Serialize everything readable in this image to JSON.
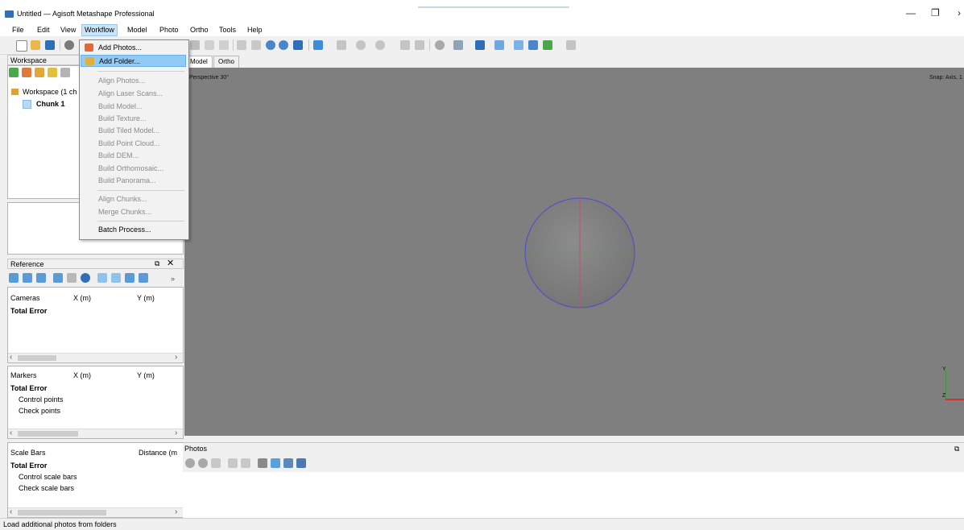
{
  "window": {
    "title": "Untitled — Agisoft Metashape Professional",
    "controls": [
      "—",
      "❐",
      "›"
    ]
  },
  "menubar": [
    "File",
    "Edit",
    "View",
    "Workflow",
    "Model",
    "Photo",
    "Ortho",
    "Tools",
    "Help"
  ],
  "workflow_menu": {
    "items": [
      {
        "label": "Add Photos...",
        "icon": "add-photos-icon",
        "enabled": true
      },
      {
        "label": "Add Folder...",
        "icon": "add-folder-icon",
        "enabled": true,
        "highlighted": true
      },
      {
        "label": "Align Photos...",
        "enabled": false
      },
      {
        "label": "Align Laser Scans...",
        "enabled": false
      },
      {
        "label": "Build Model...",
        "enabled": false
      },
      {
        "label": "Build Texture...",
        "enabled": false
      },
      {
        "label": "Build Tiled Model...",
        "enabled": false
      },
      {
        "label": "Build Point Cloud...",
        "enabled": false
      },
      {
        "label": "Build DEM...",
        "enabled": false
      },
      {
        "label": "Build Orthomosaic...",
        "enabled": false
      },
      {
        "label": "Build Panorama...",
        "enabled": false
      },
      {
        "label": "Align Chunks...",
        "enabled": false
      },
      {
        "label": "Merge Chunks...",
        "enabled": false
      },
      {
        "label": "Batch Process...",
        "enabled": true
      }
    ]
  },
  "workspace": {
    "title": "Workspace",
    "root": "Workspace (1 ch",
    "chunk": "Chunk 1"
  },
  "viewport": {
    "tabs": [
      "Model",
      "Ortho"
    ],
    "projection": "Perspective 30°",
    "snap": "Snap: Axis, 1",
    "axis_y": "Y",
    "axis_z": "Z"
  },
  "reference": {
    "title": "Reference",
    "more": "»",
    "cameras": {
      "headers": [
        "Cameras",
        "X (m)",
        "Y (m)"
      ],
      "rows": [
        "Total Error"
      ]
    },
    "markers": {
      "headers": [
        "Markers",
        "X (m)",
        "Y (m)"
      ],
      "rows": [
        "Total Error",
        "Control points",
        "Check points"
      ]
    },
    "scalebars": {
      "headers": [
        "Scale Bars",
        "Distance (m"
      ],
      "rows": [
        "Total Error",
        "Control scale bars",
        "Check scale bars"
      ]
    }
  },
  "photos": {
    "title": "Photos"
  },
  "status": "Load additional photos from folders",
  "colors": {
    "viewport_bg": "#7f7f7f",
    "menu_highlight": "#91c9f7",
    "accent_blue": "#2f6fb8"
  }
}
